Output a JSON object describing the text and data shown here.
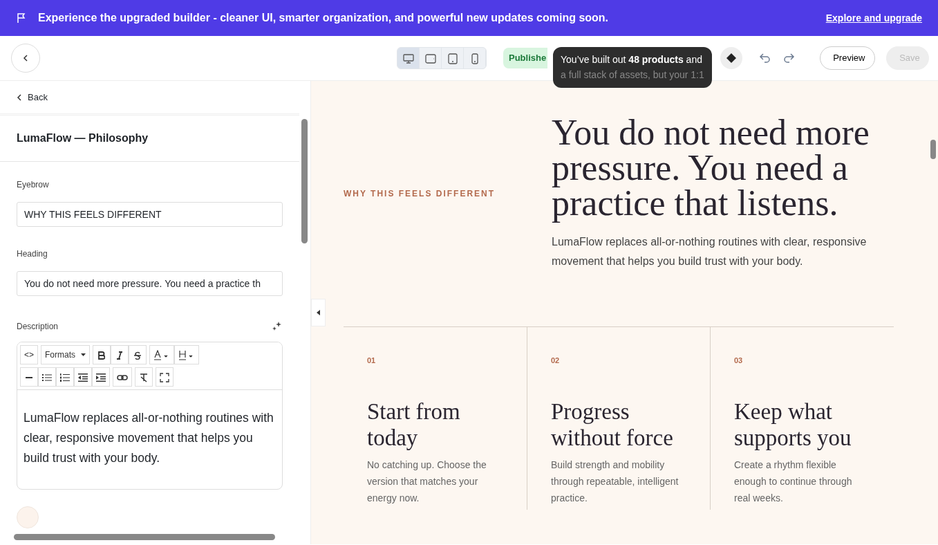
{
  "banner": {
    "text": "Experience the upgraded builder - cleaner UI, smarter organization, and powerful new updates coming soon.",
    "link": "Explore and upgrade"
  },
  "toolbar": {
    "devices": [
      {
        "kind": "desktop",
        "selected": true
      },
      {
        "kind": "tablet-landscape",
        "selected": false
      },
      {
        "kind": "tablet",
        "selected": false
      },
      {
        "kind": "phone",
        "selected": false
      }
    ],
    "status": "Publishe",
    "tooltip": [
      "You’ve built out **48 products** and",
      "a full stack of assets, but your 1:1"
    ],
    "preview": "Preview",
    "save": {
      "label": "Save",
      "disabled": true
    }
  },
  "panel": {
    "back": "Back",
    "title": "LumaFlow — Philosophy",
    "fields": [
      {
        "label": "Eyebrow",
        "value": "WHY THIS FEELS DIFFERENT"
      },
      {
        "label": "Heading",
        "value": "You do not need more pressure. You need a practice th"
      }
    ],
    "description": {
      "label": "Description",
      "code": "<>",
      "formats": "Formats",
      "text": "LumaFlow replaces all-or-nothing routines with clear, responsive movement that helps you build trust with your body."
    }
  },
  "preview": {
    "eyebrow": "WHY THIS FEELS DIFFERENT",
    "heading": "You do not need more pressure. You need a practice that listens.",
    "body": "LumaFlow replaces all-or-nothing routines with clear, responsive movement that helps you build trust with your body.",
    "steps": [
      {
        "number": "01",
        "title": "Start from today",
        "text": "No catching up. Choose the version that matches your energy now."
      },
      {
        "number": "02",
        "title": "Progress without force",
        "text": "Build strength and mobility through repeatable, intelligent practice."
      },
      {
        "number": "03",
        "title": "Keep what supports you",
        "text": "Create a rhythm flexible enough to continue through real weeks."
      }
    ]
  }
}
